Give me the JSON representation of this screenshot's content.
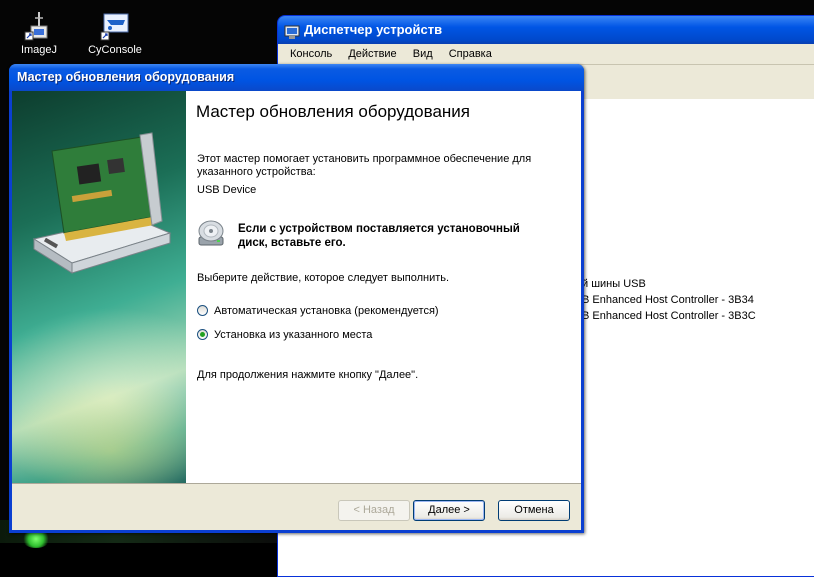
{
  "desktop": {
    "icons": [
      {
        "label": "ImageJ",
        "icon": "imagej-icon"
      },
      {
        "label": "CyConsole",
        "icon": "cyconsole-icon"
      }
    ]
  },
  "device_manager": {
    "title": "Диспетчер устройств",
    "menu": [
      "Консоль",
      "Действие",
      "Вид",
      "Справка"
    ],
    "tree_fragments": [
      "й шины USB",
      "B Enhanced Host Controller - 3B34",
      "B Enhanced Host Controller - 3B3C"
    ]
  },
  "wizard": {
    "window_title": "Мастер обновления оборудования",
    "heading": "Мастер обновления оборудования",
    "intro": "Этот мастер помогает установить программное обеспечение для указанного устройства:",
    "device_name": "USB Device",
    "cd_prompt": "Если с устройством поставляется установочный диск, вставьте его.",
    "choose_prompt": "Выберите действие, которое следует выполнить.",
    "options": [
      {
        "label": "Автоматическая установка (рекомендуется)",
        "selected": false
      },
      {
        "label": "Установка из указанного места",
        "selected": true
      }
    ],
    "continue_hint": "Для продолжения нажмите кнопку \"Далее\".",
    "buttons": {
      "back": "< Назад",
      "next": "Далее >",
      "cancel": "Отмена"
    }
  },
  "colors": {
    "titlebar_blue": "#0054e3",
    "dialog_face": "#ece9d8",
    "radio_selected": "#21a121"
  }
}
